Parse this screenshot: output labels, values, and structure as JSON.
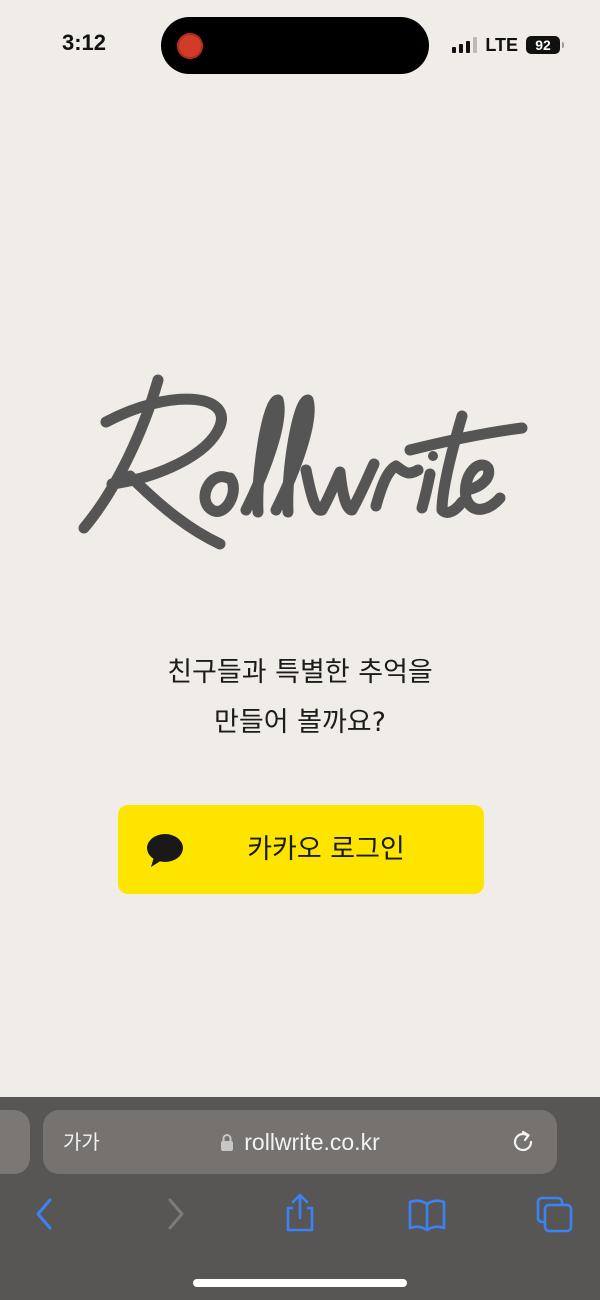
{
  "status_bar": {
    "time": "3:12",
    "network": "LTE",
    "battery": "92"
  },
  "logo": {
    "text": "Rollwrite",
    "color": "#555555"
  },
  "tagline": {
    "line1": "친구들과 특별한 추억을",
    "line2": "만들어 볼까요?"
  },
  "kakao_login": {
    "label": "카카오 로그인",
    "color": "#fee500",
    "icon": "kakao-speech-bubble-icon"
  },
  "safari": {
    "text_size_button": "가가",
    "url": "rollwrite.co.kr",
    "accent": "#3b82f6",
    "toolbar_icons": [
      "back-icon",
      "forward-icon",
      "share-icon",
      "bookmarks-icon",
      "tabs-icon"
    ]
  }
}
